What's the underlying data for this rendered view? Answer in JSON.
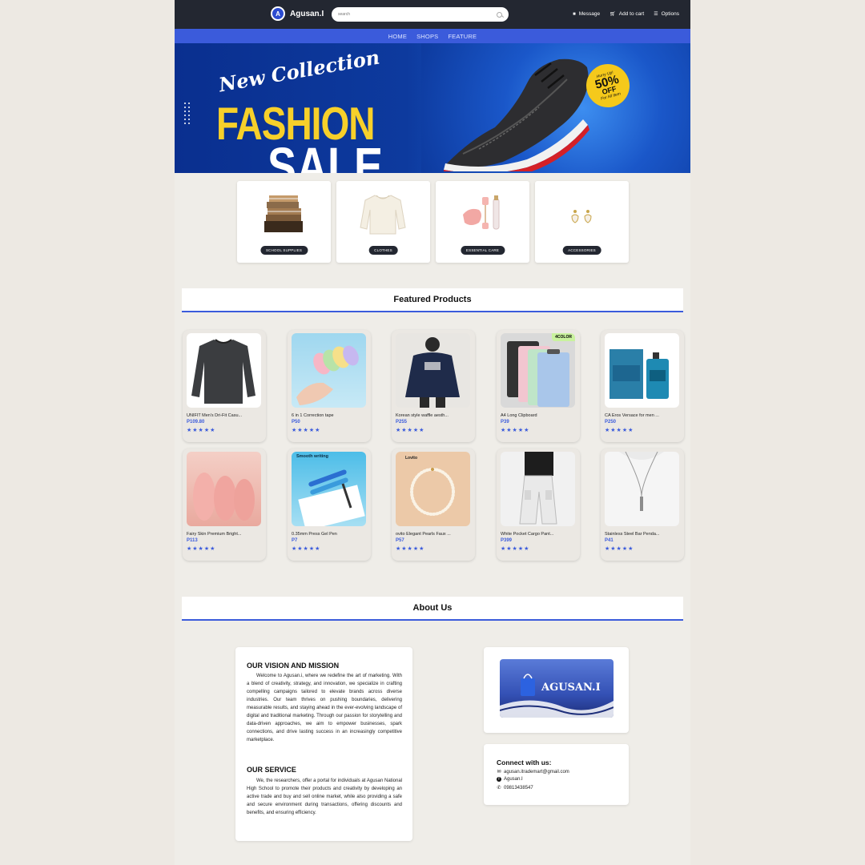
{
  "header": {
    "brand": "Agusan.I",
    "logo_letter": "A",
    "search_placeholder": "search",
    "actions": [
      {
        "label": "Message",
        "icon": "chat-icon"
      },
      {
        "label": "Add to cart",
        "icon": "cart-icon"
      },
      {
        "label": "Options",
        "icon": "list-icon"
      }
    ]
  },
  "nav": {
    "items": [
      "HOME",
      "SHOPS",
      "FEATURE"
    ]
  },
  "hero": {
    "line1": "New Collection",
    "line2": "FASHION",
    "line3": "SALE",
    "tag_top": "Hurry Up!",
    "tag_main": "50%",
    "tag_off": "OFF",
    "tag_bottom": "For All Item"
  },
  "categories": [
    {
      "label": "SCHOOL SUPPLIES",
      "icon": "books-icon"
    },
    {
      "label": "CLOTHES",
      "icon": "sweater-icon"
    },
    {
      "label": "ESSENTIAL CARE",
      "icon": "face-roller-icon"
    },
    {
      "label": "ACCESSORIES",
      "icon": "earrings-icon"
    }
  ],
  "featured": {
    "title": "Featured Products",
    "products": [
      {
        "name": "UNIFIT Men's Dri-Fit Casu...",
        "price": "P109.80",
        "stars": "★★★★★"
      },
      {
        "name": "6 in 1 Correction tape",
        "price": "P50",
        "stars": "★★★★★"
      },
      {
        "name": "Korean style waffle aesth...",
        "price": "P255",
        "stars": "★★★★★"
      },
      {
        "name": "A4 Long Clipboard",
        "price": "P39",
        "stars": "★★★★★",
        "badge": "4COLOR"
      },
      {
        "name": "CA Eros Versace for men ...",
        "price": "P250",
        "stars": "★★★★★"
      },
      {
        "name": "Fairy Skin Premium Bright...",
        "price": "P113",
        "stars": "★★★★★"
      },
      {
        "name": "0.35mm Press Gel Pen",
        "price": "P7",
        "stars": "★★★★★",
        "badge": "Smooth writing"
      },
      {
        "name": "ovito Elegant Pearls Faux ...",
        "price": "P57",
        "stars": "★★★★★",
        "badge": "Lovito"
      },
      {
        "name": "White Pocket Cargo Pant...",
        "price": "P399",
        "stars": "★★★★★"
      },
      {
        "name": "Stainless Steel Bar Penda...",
        "price": "P41",
        "stars": "★★★★★"
      }
    ]
  },
  "about": {
    "title": "About Us",
    "vision_heading": "OUR VISION AND MISSION",
    "vision_text": "Welcome to Agusan.i, where we redefine the art of marketing. With a blend of creativity, strategy, and innovation, we specialize in crafting compelling campaigns tailored to elevate brands across diverse industries. Our team thrives on pushing boundaries, delivering measurable results, and staying ahead in the ever-evolving landscape of digital and traditional marketing. Through our passion for storytelling and data-driven approaches, we aim to empower businesses, spark connections, and drive lasting success in an increasingly competitive marketplace.",
    "service_heading": "OUR SERVICE",
    "service_text": "We, the researchers, offer a portal for individuals at Agusan National High School to promote their products and creativity by developing an active trade and buy and sell online market, while also providing a safe and secure environment during transactions, offering discounts and benefits, and ensuring efficiency.",
    "brand_banner": "AGUSAN.I",
    "connect_heading": "Connect with us:",
    "email": "agusan.itrademart@gmail.com",
    "facebook": "Agusan.I",
    "phone": "09813438547"
  }
}
